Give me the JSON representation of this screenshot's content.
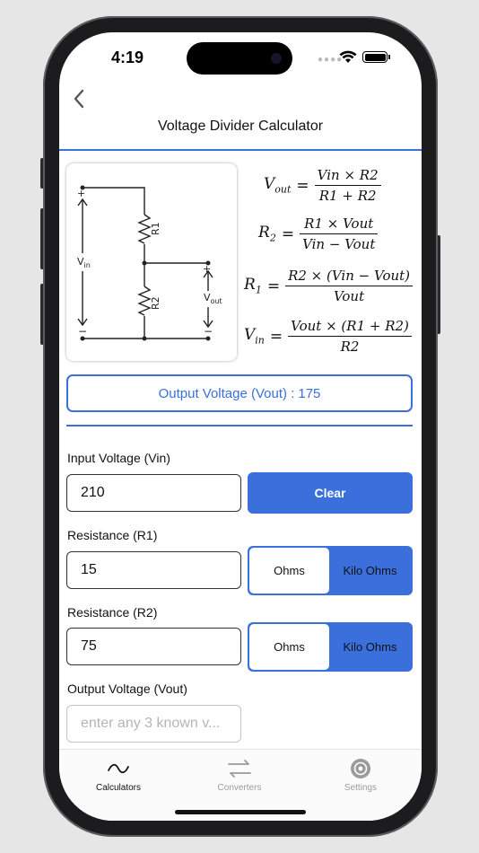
{
  "status_bar": {
    "time": "4:19"
  },
  "header": {
    "title": "Voltage Divider Calculator"
  },
  "circuit": {
    "r1_label": "R1",
    "r2_label": "R2",
    "vin_label": "V",
    "vin_sub": "in",
    "vout_label": "V",
    "vout_sub": "out",
    "plus": "+",
    "minus": "−"
  },
  "formulas": {
    "vout": {
      "lhs": "V",
      "lhs_sub": "out",
      "num": "Vin × R2",
      "den": "R1 + R2"
    },
    "r2": {
      "lhs": "R",
      "lhs_sub": "2",
      "num": "R1 × Vout",
      "den": "Vin − Vout"
    },
    "r1": {
      "lhs": "R",
      "lhs_sub": "1",
      "num": "R2 × (Vin − Vout)",
      "den": "Vout"
    },
    "vin": {
      "lhs": "V",
      "lhs_sub": "in",
      "num": "Vout × (R1 + R2)",
      "den": "R2"
    }
  },
  "output": {
    "label": "Output Voltage (Vout) :",
    "value": "175"
  },
  "fields": {
    "vin": {
      "label": "Input Voltage (Vin)",
      "value": "210"
    },
    "r1": {
      "label": "Resistance (R1)",
      "value": "15"
    },
    "r2": {
      "label": "Resistance (R2)",
      "value": "75"
    },
    "vout": {
      "label": "Output Voltage (Vout)",
      "placeholder": "enter any 3 known v..."
    }
  },
  "buttons": {
    "clear": "Clear"
  },
  "unit_toggle": {
    "ohms": "Ohms",
    "kilo_ohms": "Kilo Ohms",
    "selected": "Ohms"
  },
  "tabbar": {
    "items": [
      {
        "label": "Calculators",
        "icon": "wave-icon",
        "active": true
      },
      {
        "label": "Converters",
        "icon": "arrows-swap-icon",
        "active": false
      },
      {
        "label": "Settings",
        "icon": "gear-icon",
        "active": false
      }
    ]
  },
  "colors": {
    "accent": "#3a6fdc",
    "inactive": "#9b9b9b"
  }
}
